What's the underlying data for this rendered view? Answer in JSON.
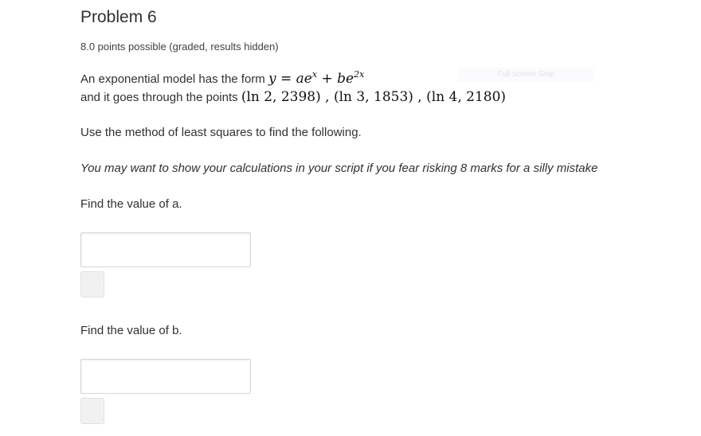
{
  "problem": {
    "title": "Problem 6",
    "points": "8.0 points possible (graded, results hidden)"
  },
  "intro": {
    "line1_text": "An exponential model has the form ",
    "model_y": "y",
    "model_eq": " = ",
    "model_a": "a",
    "model_e1": "e",
    "model_exp1": "x",
    "model_plus": " + ",
    "model_b": "b",
    "model_e2": "e",
    "model_exp2": "2x",
    "line2_text": "and it goes through the points ",
    "points_math": "(ln 2, 2398) , (ln 3, 1853) , (ln 4, 2180)"
  },
  "full_screen_label": "Full screen Snip",
  "method_text": "Use the method of least squares to find the following.",
  "note_text": "You may want to show your calculations in your script if you fear risking 8 marks for a silly mistake",
  "question_a": {
    "prompt": "Find the value of a.",
    "value": ""
  },
  "question_b": {
    "prompt": "Find the value of b.",
    "value": ""
  }
}
